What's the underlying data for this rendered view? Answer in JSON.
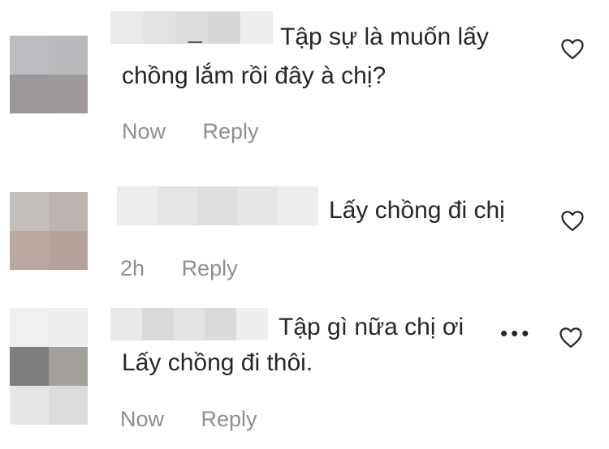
{
  "comments": [
    {
      "text_line1": "Tập sự là muốn lấy",
      "text_line2": "chồng lắm rồi đây à chị?",
      "username_suffix": "_",
      "time": "Now",
      "reply_label": "Reply",
      "avatar_colors": [
        "#bdbcc1",
        "#b9b8bc",
        "#9a9699",
        "#a09b9a"
      ],
      "name_colors": [
        "#e9e9e9",
        "#e2e2e2",
        "#dcdcdc",
        "#d6d6d6",
        "#ededed"
      ],
      "icon": "heart-outline-icon"
    },
    {
      "text_line1": "Lấy chồng đi chị",
      "time": "2h",
      "reply_label": "Reply",
      "avatar_colors": [
        "#c3bfbc",
        "#bdb4b2",
        "#bba8a2",
        "#b6a29d"
      ],
      "name_colors": [
        "#ececec",
        "#e4e4e4",
        "#dedede",
        "#e6e6e6",
        "#eeeeee"
      ],
      "icon": "heart-outline-icon"
    },
    {
      "text_line1": "Tập gì nữa chị ơi",
      "text_line2": "Lấy chồng đi thôi.",
      "time": "Now",
      "reply_label": "Reply",
      "avatar_colors": [
        "#f1f0f0",
        "#eeeeee",
        "#7f7d80",
        "#a3a09c",
        "#e6e5e5",
        "#dcdbdc"
      ],
      "name_colors": [
        "#e8e8e8",
        "#d9d9d9",
        "#e3e3e3",
        "#dadada",
        "#efefef"
      ],
      "icon": "heart-outline-icon",
      "more_icon": "more-dots-icon",
      "more_glyph": "•••"
    }
  ]
}
